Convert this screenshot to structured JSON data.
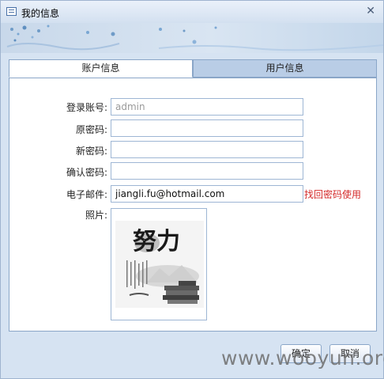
{
  "window": {
    "title": "我的信息",
    "close_glyph": "✕",
    "icon": "window-icon"
  },
  "tabs": [
    {
      "label": "账户信息",
      "selected": true
    },
    {
      "label": "用户信息",
      "selected": false
    }
  ],
  "form": {
    "account": {
      "label": "登录账号:",
      "value": "admin"
    },
    "old_password": {
      "label": "原密码:",
      "value": ""
    },
    "new_password": {
      "label": "新密码:",
      "value": ""
    },
    "confirm_password": {
      "label": "确认密码:",
      "value": ""
    },
    "email": {
      "label": "电子邮件:",
      "value": "jiangli.fu@hotmail.com",
      "hint": "找回密码使用"
    },
    "photo": {
      "label": "照片:",
      "image_text": "努力"
    }
  },
  "buttons": {
    "ok": "确定",
    "cancel": "取消"
  },
  "watermark": "www.wooyun.org",
  "colors": {
    "hint": "#d42a2a",
    "tab_selected": "#ffffff",
    "tab_unselected": "#b9cde6",
    "frame": "#d6e3f2"
  }
}
